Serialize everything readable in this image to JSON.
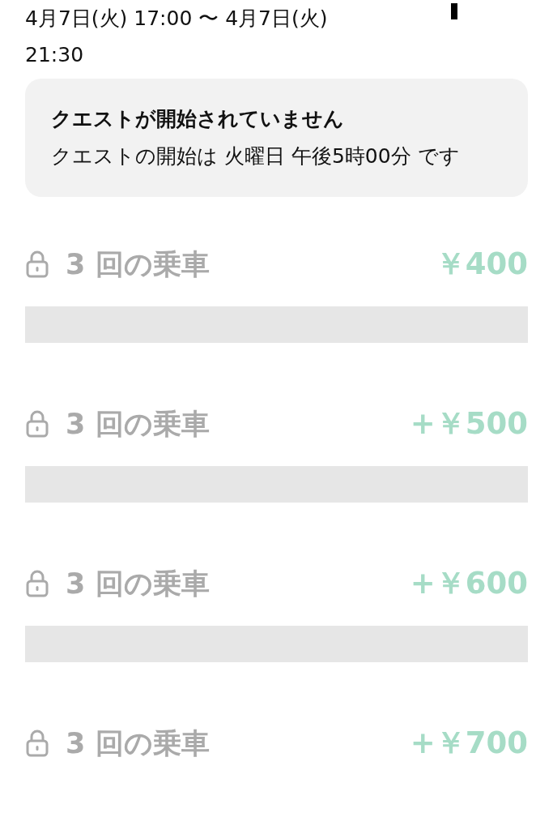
{
  "period": {
    "start": "4月7日(火) 17:00 〜 4月7日(火)",
    "end": "21:30"
  },
  "notice": {
    "title": "クエストが開始されていません",
    "message": "クエストの開始は 火曜日 午後5時00分 です"
  },
  "steps": [
    {
      "label": "3 回の乗車",
      "reward": "￥400",
      "locked": true
    },
    {
      "label": "3 回の乗車",
      "reward": "+￥500",
      "locked": true
    },
    {
      "label": "3 回の乗車",
      "reward": "+￥600",
      "locked": true
    },
    {
      "label": "3 回の乗車",
      "reward": "+￥700",
      "locked": true
    }
  ]
}
